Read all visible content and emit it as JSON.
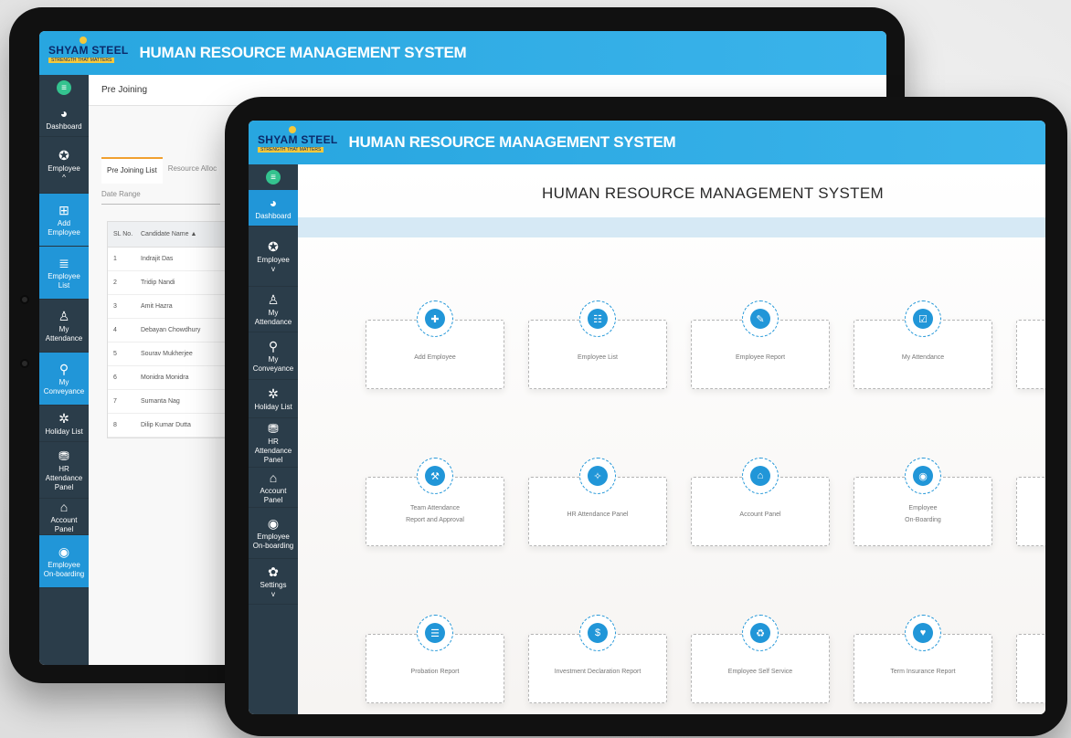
{
  "brand": {
    "name": "SHYAM STEEL",
    "tagline": "STRENGTH THAT MATTERS",
    "system_title": "HUMAN RESOURCE MANAGEMENT SYSTEM"
  },
  "colors": {
    "header": "#28a6e0",
    "sidebar": "#2b3d4a",
    "active": "#2196d8",
    "accent": "#f0a030"
  },
  "back_screen": {
    "page_title": "Pre Joining",
    "tabs": [
      "Pre Joining List",
      "Resource Alloc"
    ],
    "date_range_placeholder": "Date Range",
    "table": {
      "headers": [
        "SL No.",
        "Candidate Name"
      ],
      "rows": [
        [
          "1",
          "Indrajit Das"
        ],
        [
          "2",
          "Tridip Nandi"
        ],
        [
          "3",
          "Amit Hazra"
        ],
        [
          "4",
          "Debayan Chowdhury"
        ],
        [
          "5",
          "Sourav Mukherjee"
        ],
        [
          "6",
          "Monidra Monidra"
        ],
        [
          "7",
          "Sumanta Nag"
        ],
        [
          "8",
          "Dilip Kumar Dutta"
        ]
      ]
    },
    "sidebar": [
      {
        "icon": "dashboard-icon",
        "glyph": "◕",
        "label": "Dashboard"
      },
      {
        "icon": "employee-icon",
        "glyph": "✪",
        "label": "Employee"
      },
      {
        "icon": "add-employee-icon",
        "glyph": "⊞",
        "label": "Add Employee"
      },
      {
        "icon": "list-icon",
        "glyph": "≣",
        "label": "Employee List"
      },
      {
        "icon": "attendance-icon",
        "glyph": "♙",
        "label": "My Attendance"
      },
      {
        "icon": "conveyance-icon",
        "glyph": "⚲",
        "label": "My Conveyance"
      },
      {
        "icon": "holiday-icon",
        "glyph": "✲",
        "label": "Holiday List"
      },
      {
        "icon": "hr-attendance-icon",
        "glyph": "⛃",
        "label": "HR Attendance Panel"
      },
      {
        "icon": "account-icon",
        "glyph": "⌂",
        "label": "Account Panel"
      },
      {
        "icon": "onboarding-icon",
        "glyph": "◉",
        "label": "Employee On-boarding"
      }
    ]
  },
  "front_screen": {
    "page_title": "HUMAN RESOURCE MANAGEMENT SYSTEM",
    "sidebar": [
      {
        "icon": "dashboard-icon",
        "glyph": "◕",
        "label": "Dashboard"
      },
      {
        "icon": "employee-icon",
        "glyph": "✪",
        "label": "Employee"
      },
      {
        "icon": "attendance-icon",
        "glyph": "♙",
        "label": "My Attendance"
      },
      {
        "icon": "conveyance-icon",
        "glyph": "⚲",
        "label": "My Conveyance"
      },
      {
        "icon": "holiday-icon",
        "glyph": "✲",
        "label": "Holiday List"
      },
      {
        "icon": "hr-attendance-icon",
        "glyph": "⛃",
        "label": "HR Attendance Panel"
      },
      {
        "icon": "account-icon",
        "glyph": "⌂",
        "label": "Account Panel"
      },
      {
        "icon": "onboarding-icon",
        "glyph": "◉",
        "label": "Employee On-boarding"
      },
      {
        "icon": "settings-icon",
        "glyph": "✿",
        "label": "Settings"
      }
    ],
    "cards": [
      {
        "icon": "add-employee-icon",
        "glyph": "✚",
        "label": "Add Employee",
        "label2": ""
      },
      {
        "icon": "employee-list-icon",
        "glyph": "☷",
        "label": "Employee List",
        "label2": ""
      },
      {
        "icon": "employee-report-icon",
        "glyph": "✎",
        "label": "Employee Report",
        "label2": ""
      },
      {
        "icon": "calendar-icon",
        "glyph": "☑",
        "label": "My Attendance",
        "label2": ""
      },
      {
        "icon": "gavel-icon",
        "glyph": "⚒",
        "label": "Team Attendance",
        "label2": "Report and Approval"
      },
      {
        "icon": "handshake-icon",
        "glyph": "✧",
        "label": "HR Attendance Panel",
        "label2": ""
      },
      {
        "icon": "bank-icon",
        "glyph": "⌂",
        "label": "Account Panel",
        "label2": ""
      },
      {
        "icon": "onboarding-icon",
        "glyph": "◉",
        "label": "Employee",
        "label2": "On-Boarding"
      },
      {
        "icon": "probation-icon",
        "glyph": "☰",
        "label": "Probation Report",
        "label2": ""
      },
      {
        "icon": "investment-icon",
        "glyph": "$",
        "label": "Investment Declaration Report",
        "label2": ""
      },
      {
        "icon": "self-service-icon",
        "glyph": "♻",
        "label": "Employee Self Service",
        "label2": ""
      },
      {
        "icon": "insurance-icon",
        "glyph": "♥",
        "label": "Term Insurance Report",
        "label2": ""
      }
    ]
  }
}
